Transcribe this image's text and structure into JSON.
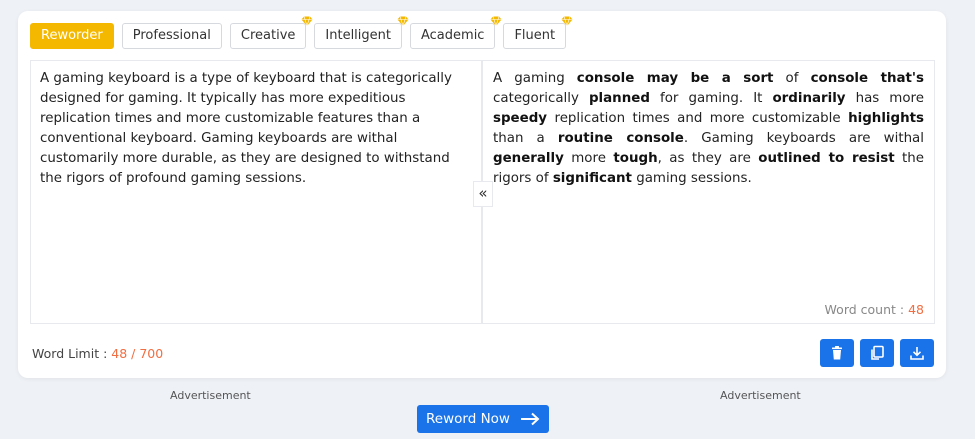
{
  "modes": [
    {
      "label": "Reworder",
      "active": true,
      "premium": false
    },
    {
      "label": "Professional",
      "active": false,
      "premium": false
    },
    {
      "label": "Creative",
      "active": false,
      "premium": true
    },
    {
      "label": "Intelligent",
      "active": false,
      "premium": true
    },
    {
      "label": "Academic",
      "active": false,
      "premium": true
    },
    {
      "label": "Fluent",
      "active": false,
      "premium": true
    }
  ],
  "input_text": "A gaming keyboard is a type of keyboard that is categorically designed for gaming. It typically has more expeditious replication times and more customizable features than a conventional keyboard. Gaming keyboards are withal customarily more durable, as they are designed to withstand the rigors of profound gaming sessions.",
  "output_segments": [
    {
      "t": "A gaming ",
      "b": false
    },
    {
      "t": "console may be a sort",
      "b": true
    },
    {
      "t": " of ",
      "b": false
    },
    {
      "t": "console that's",
      "b": true
    },
    {
      "t": " categorically ",
      "b": false
    },
    {
      "t": "planned",
      "b": true
    },
    {
      "t": " for gaming. It ",
      "b": false
    },
    {
      "t": "ordinarily",
      "b": true
    },
    {
      "t": " has more ",
      "b": false
    },
    {
      "t": "speedy",
      "b": true
    },
    {
      "t": " replication times and more customizable ",
      "b": false
    },
    {
      "t": "highlights",
      "b": true
    },
    {
      "t": " than a ",
      "b": false
    },
    {
      "t": "routine console",
      "b": true
    },
    {
      "t": ". Gaming keyboards are withal ",
      "b": false
    },
    {
      "t": "generally",
      "b": true
    },
    {
      "t": " more ",
      "b": false
    },
    {
      "t": "tough",
      "b": true
    },
    {
      "t": ", as they are ",
      "b": false
    },
    {
      "t": "outlined to resist",
      "b": true
    },
    {
      "t": " the rigors of ",
      "b": false
    },
    {
      "t": "significant",
      "b": true
    },
    {
      "t": " gaming sessions.",
      "b": false
    }
  ],
  "collapse_glyph": "«",
  "word_count": {
    "label": "Word count :",
    "value": "48"
  },
  "word_limit": {
    "label": "Word Limit :",
    "value": "48 / 700"
  },
  "actions": [
    {
      "name": "delete-button",
      "icon": "trash-icon"
    },
    {
      "name": "copy-button",
      "icon": "copy-icon"
    },
    {
      "name": "download-button",
      "icon": "download-icon"
    }
  ],
  "ads": {
    "left": "Advertisement",
    "right": "Advertisement"
  },
  "reword_button": {
    "label": "Reword Now",
    "icon": "arrow-right-icon"
  },
  "colors": {
    "accent": "#1a73e8",
    "active_mode": "#f5b800",
    "count": "#f06e42",
    "gem": "#f5b800"
  }
}
